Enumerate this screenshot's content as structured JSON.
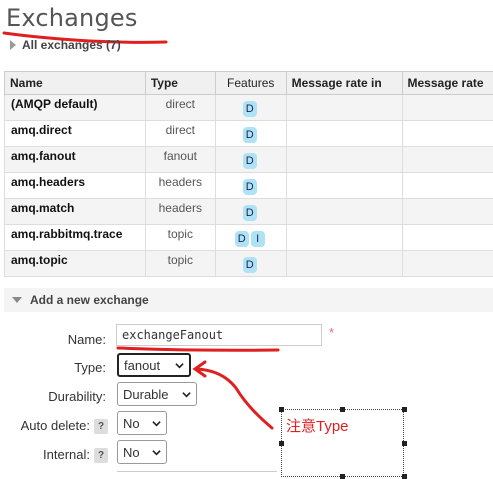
{
  "page": {
    "title": "Exchanges"
  },
  "section": {
    "toggle_label": "All exchanges (7)"
  },
  "table": {
    "headers": [
      "Name",
      "Type",
      "Features",
      "Message rate in",
      "Message rate"
    ],
    "rows": [
      {
        "name": "(AMQP default)",
        "type": "direct",
        "features": [
          "D"
        ]
      },
      {
        "name": "amq.direct",
        "type": "direct",
        "features": [
          "D"
        ]
      },
      {
        "name": "amq.fanout",
        "type": "fanout",
        "features": [
          "D"
        ]
      },
      {
        "name": "amq.headers",
        "type": "headers",
        "features": [
          "D"
        ]
      },
      {
        "name": "amq.match",
        "type": "headers",
        "features": [
          "D"
        ]
      },
      {
        "name": "amq.rabbitmq.trace",
        "type": "topic",
        "features": [
          "D",
          "I"
        ]
      },
      {
        "name": "amq.topic",
        "type": "topic",
        "features": [
          "D"
        ]
      }
    ]
  },
  "add_form": {
    "header": "Add a new exchange",
    "name_label": "Name:",
    "name_value": "exchangeFanout",
    "required_mark": "*",
    "type_label": "Type:",
    "type_value": "fanout",
    "durability_label": "Durability:",
    "durability_value": "Durable",
    "auto_delete_label": "Auto delete:",
    "auto_delete_value": "No",
    "internal_label": "Internal:",
    "internal_value": "No",
    "help_mark": "?"
  },
  "annotation": {
    "text": "注意Type",
    "color": "#e02020"
  },
  "colors": {
    "badge": "#aee3f5",
    "annotation_red": "#e02020"
  }
}
